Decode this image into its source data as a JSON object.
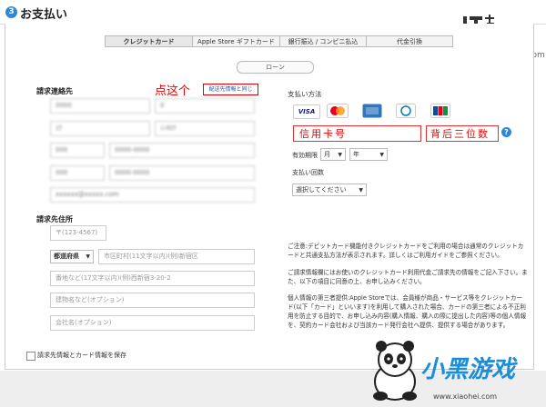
{
  "header": {
    "step_number": "3",
    "title": "お支払い"
  },
  "watermark": {
    "brand": "IT之家",
    "url": "www.ithome.com"
  },
  "tabs": [
    {
      "label": "クレジットカード",
      "active": true
    },
    {
      "label": "Apple Store ギフトカード",
      "active": false
    },
    {
      "label": "銀行振込 / コンビニ払込",
      "active": false
    },
    {
      "label": "代金引換",
      "active": false
    }
  ],
  "loan_button": "ローン",
  "billing_contact": {
    "label": "請求連絡先",
    "copy_link": "配送先情報と同じ",
    "annotation": "点这个",
    "fields": [
      {
        "value": "0000",
        "placeholder": ""
      },
      {
        "value": "0",
        "placeholder": ""
      },
      {
        "value": "ﾕｳ",
        "placeholder": ""
      },
      {
        "value": "ｼﾝﾀﾛｳ",
        "placeholder": ""
      },
      {
        "value": "000",
        "placeholder": ""
      },
      {
        "value": "0000-0000",
        "placeholder": ""
      },
      {
        "value": "000",
        "placeholder": ""
      },
      {
        "value": "0000-0000",
        "placeholder": ""
      },
      {
        "value": "xxxxxx@xxxxx.com",
        "placeholder": ""
      }
    ]
  },
  "billing_address": {
    "label": "請求先住所",
    "zip_placeholder": "〒(123-4567)",
    "prefecture": "都道府県",
    "city_placeholder": "市区町村(11文字以内)(例)新宿区",
    "street_placeholder": "番地など(17文字以内)(例)西新宿3-20-2",
    "building_placeholder": "建物名など(オプション)",
    "company_placeholder": "会社名(オプション)"
  },
  "save_checkbox_label": "請求先情報とカード情報を保存",
  "payment": {
    "label": "支払い方法",
    "cards": [
      {
        "name": "VISA",
        "color": "#1a1f71"
      },
      {
        "name": "MC",
        "color": "#eb001b"
      },
      {
        "name": "AMEX",
        "color": "#2e77bc"
      },
      {
        "name": "DC",
        "color": "#0079be"
      },
      {
        "name": "JCB",
        "color": "#0e4c96"
      }
    ],
    "card_number_annotation": "信用卡号",
    "cvv_annotation": "背后三位数",
    "expiry_label": "有効期限",
    "month": "月",
    "year": "年",
    "installments_label": "支払い回数",
    "installments_select": "選択してください"
  },
  "notice": {
    "p1": "ご注意:デビットカード機能付きクレジットカードをご利用の場合は通常のクレジットカードと共通支払方法が表示されます。詳しくはご利用ガイドをご参照ください。",
    "p2": "ご請求情報欄にはお使いのクレジットカード利用代金ご請求先の情報をご記入下さい。また、以下の項目に同意の上、お申し込みください。",
    "p3": "個人情報の第三者提供:Apple Storeでは、会員様が商品・サービス等をクレジットカード(以下「カード」といいます)を利用して購入された場合、カードの第三者による不正利用を防止する目的で、お申し込み内容(購入情報、購入の際に提出した内容)等の個人情報を、契約カード会社および当該カード発行会社へ提供、提供する場合があります。"
  },
  "brand_logo": {
    "text": "小黑游戏",
    "url": "www.xiaohei.com"
  }
}
